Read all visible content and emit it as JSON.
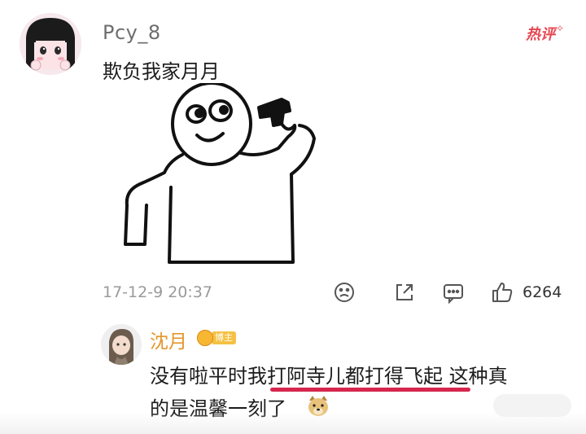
{
  "comment": {
    "username": "Pcy_8",
    "hot_label": "热评",
    "text": "欺负我家月月",
    "meme_icon": "stick-figure-pointing-gun-meme",
    "timestamp": "17-12-9 20:37",
    "actions": {
      "dislike_icon": "frown-face-icon",
      "share_icon": "share-icon",
      "reply_icon": "comment-icon",
      "like_icon": "thumbs-up-icon",
      "like_count": "6264"
    }
  },
  "reply": {
    "username": "沈月",
    "badge_label": "博主",
    "line1": "没有啦平时我打阿寺儿都打得飞起 这种真",
    "line2": "的是温馨一刻了",
    "emoji_icon": "dog-emoji-icon"
  },
  "colors": {
    "username_reply": "#e3962a",
    "hot": "#e54852",
    "underline": "#d6264d"
  }
}
